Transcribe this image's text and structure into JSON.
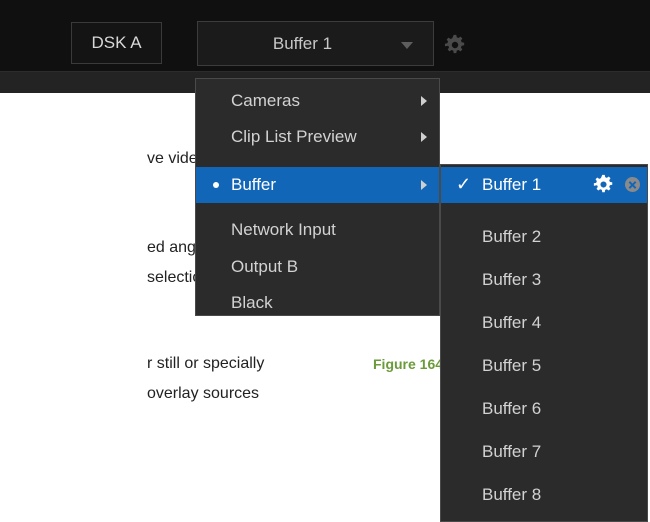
{
  "toolbar": {
    "dsk_label": "DSK A",
    "source_label": "Buffer 1"
  },
  "document": {
    "lines": [
      "ve video source",
      "ed  angle  from",
      "selection    (not",
      "r still or specially",
      " overlay sources"
    ],
    "figure_caption": "Figure 164"
  },
  "source_menu": {
    "items": [
      {
        "label": "Cameras",
        "submenu": true
      },
      {
        "label": "Clip List Preview",
        "submenu": true
      },
      {
        "label": "Buffer",
        "submenu": true,
        "selected": true
      },
      {
        "label": "Network Input",
        "submenu": false
      },
      {
        "label": "Output B",
        "submenu": false
      },
      {
        "label": "Black",
        "submenu": false
      }
    ]
  },
  "buffer_menu": {
    "items": [
      {
        "label": "Buffer 1",
        "checked": true
      },
      {
        "label": "Buffer 2"
      },
      {
        "label": "Buffer 3"
      },
      {
        "label": "Buffer 4"
      },
      {
        "label": "Buffer 5"
      },
      {
        "label": "Buffer 6"
      },
      {
        "label": "Buffer 7"
      },
      {
        "label": "Buffer 8"
      }
    ],
    "check_mark": "✓"
  },
  "colors": {
    "highlight": "#1266b8",
    "menu_bg": "#2b2b2b",
    "caption_green": "#6a9a3a"
  },
  "icons": [
    "gear-icon",
    "caret-down-icon",
    "submenu-arrow-icon",
    "close-icon",
    "bullet-icon",
    "check-icon"
  ]
}
